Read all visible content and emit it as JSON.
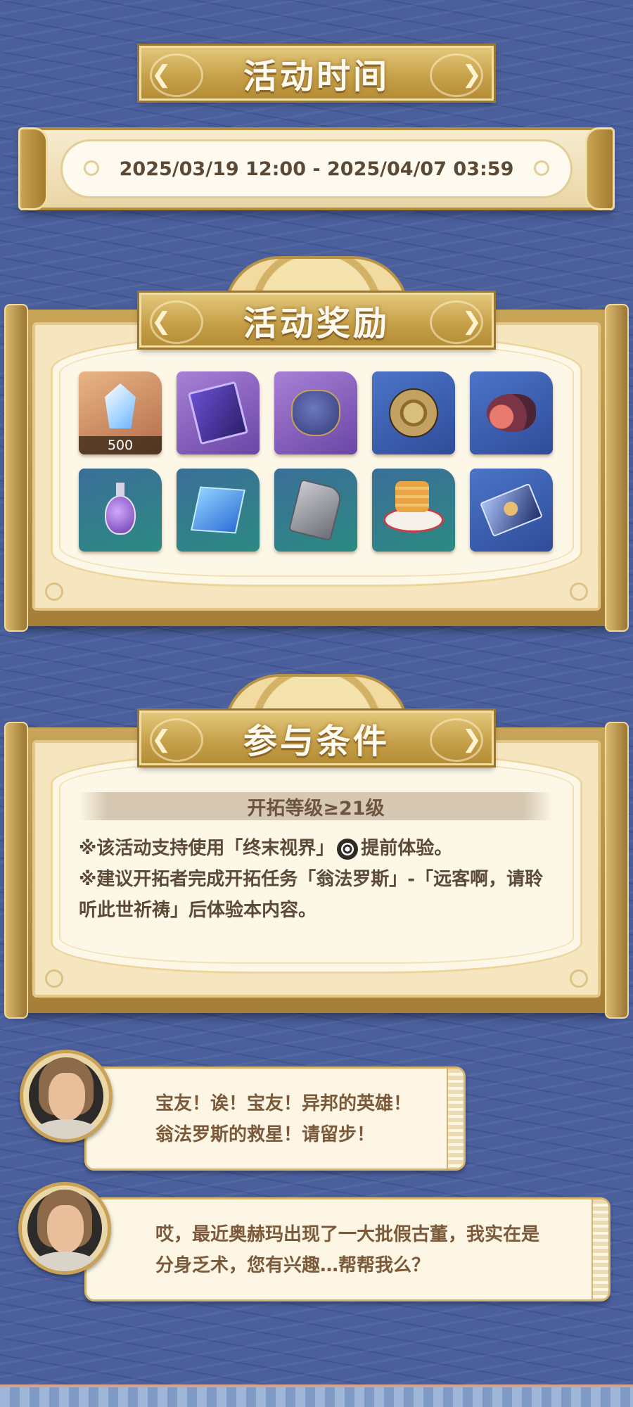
{
  "time_section": {
    "title": "活动时间",
    "range": "2025/03/19 12:00 - 2025/04/07 03:59"
  },
  "rewards_section": {
    "title": "活动奖励",
    "items": [
      {
        "icon": "crystal-icon",
        "rarity": "gold",
        "count": "500"
      },
      {
        "icon": "book-icon",
        "rarity": "purple"
      },
      {
        "icon": "pouch-icon",
        "rarity": "purple"
      },
      {
        "icon": "medal-icon",
        "rarity": "blue"
      },
      {
        "icon": "meat-icon",
        "rarity": "blue"
      },
      {
        "icon": "potion-icon",
        "rarity": "green"
      },
      {
        "icon": "cube-icon",
        "rarity": "green"
      },
      {
        "icon": "tablet-icon",
        "rarity": "green"
      },
      {
        "icon": "pancake-icon",
        "rarity": "green"
      },
      {
        "icon": "card-icon",
        "rarity": "blue"
      }
    ]
  },
  "conditions_section": {
    "title": "参与条件",
    "requirement": "开拓等级≥21级",
    "line1_before": "※该活动支持使用「终末视界」",
    "line1_after": "提前体验。",
    "line2": "※建议开拓者完成开拓任务「翁法罗斯」-「远客啊，请聆",
    "line3": "听此世祈祷」后体验本内容。"
  },
  "dialogues": [
    {
      "lines": [
        "宝友！诶！宝友！异邦的英雄！",
        "翁法罗斯的救星！请留步！"
      ]
    },
    {
      "lines": [
        "哎，最近奥赫玛出现了一大批假古董，我实在是",
        "分身乏术，您有兴趣…帮帮我么？"
      ]
    }
  ],
  "colors": {
    "background": "#4a5f9c",
    "gold": "#c59f47",
    "parchment": "#fdf7e8",
    "text_dark": "#5b4a36",
    "dialog_text": "#7a5a3a"
  }
}
